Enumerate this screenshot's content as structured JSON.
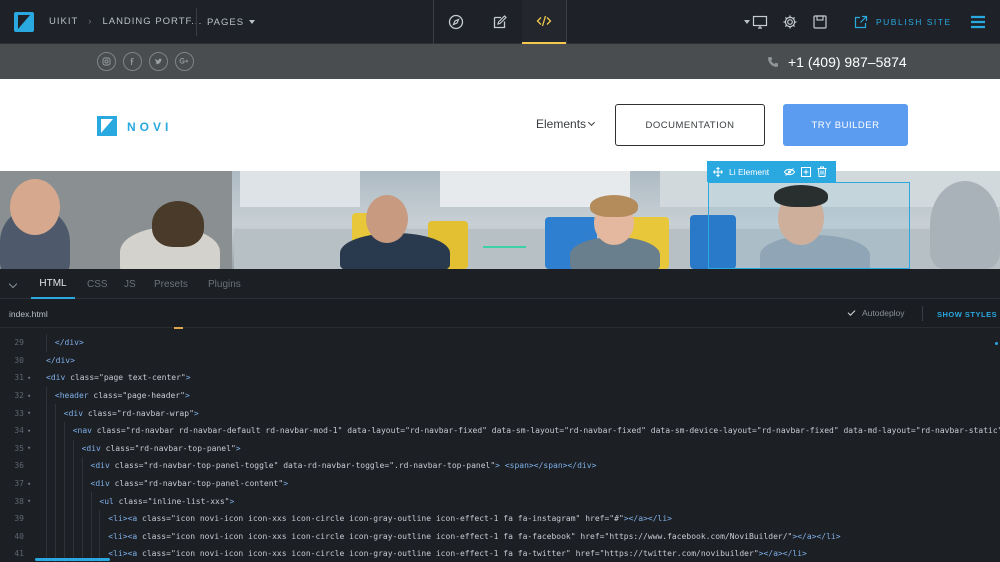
{
  "topbar": {
    "breadcrumb": [
      "UIKIT",
      "LANDING PORTF..."
    ],
    "breadcrumb_sep": "›",
    "pages_label": "PAGES",
    "modes": [
      {
        "icon": "compass-icon",
        "active": false
      },
      {
        "icon": "edit-icon",
        "active": false
      },
      {
        "icon": "code-icon",
        "active": true
      }
    ],
    "tools": [
      "monitor-icon",
      "gear-icon",
      "save-icon"
    ],
    "publish_label": "PUBLISH SITE"
  },
  "site": {
    "phone": "+1 (409) 987–5874",
    "socials": [
      "instagram-icon",
      "facebook-icon",
      "twitter-icon",
      "google-plus-icon"
    ],
    "brand": "NOVI",
    "elements_label": "Elements",
    "documentation_label": "DOCUMENTATION",
    "try_label": "TRY BUILDER",
    "selection_label": "Li Element"
  },
  "editor": {
    "tabs": [
      {
        "label": "HTML",
        "active": true
      },
      {
        "label": "CSS",
        "active": false
      },
      {
        "label": "JS",
        "active": false
      },
      {
        "label": "Presets",
        "active": false
      },
      {
        "label": "Plugins",
        "active": false
      }
    ],
    "filename": "index.html",
    "autodeploy_label": "Autodeploy",
    "show_styles_label": "SHOW STYLES",
    "lines": [
      {
        "n": "29",
        "fold": false,
        "indent": 1,
        "code": "</div>"
      },
      {
        "n": "30",
        "fold": false,
        "indent": 0,
        "code": "</div>"
      },
      {
        "n": "31",
        "fold": true,
        "indent": 0,
        "code": "<div class=\"page text-center\">"
      },
      {
        "n": "32",
        "fold": true,
        "indent": 1,
        "code": "<header class=\"page-header\">"
      },
      {
        "n": "33",
        "fold": true,
        "indent": 2,
        "code": "<div class=\"rd-navbar-wrap\">"
      },
      {
        "n": "34",
        "fold": true,
        "indent": 3,
        "code": "<nav class=\"rd-navbar rd-navbar-default rd-navbar-mod-1\" data-layout=\"rd-navbar-fixed\" data-sm-layout=\"rd-navbar-fixed\" data-sm-device-layout=\"rd-navbar-fixed\" data-md-layout=\"rd-navbar-static\" data-md-device"
      },
      {
        "n": "35",
        "fold": true,
        "indent": 4,
        "code": "<div class=\"rd-navbar-top-panel\">"
      },
      {
        "n": "36",
        "fold": false,
        "indent": 5,
        "code": "<div class=\"rd-navbar-top-panel-toggle\" data-rd-navbar-toggle=\".rd-navbar-top-panel\"> <span></span></div>"
      },
      {
        "n": "37",
        "fold": true,
        "indent": 5,
        "code": "<div class=\"rd-navbar-top-panel-content\">"
      },
      {
        "n": "38",
        "fold": true,
        "indent": 6,
        "code": "<ul class=\"inline-list-xxs\">"
      },
      {
        "n": "39",
        "fold": false,
        "indent": 7,
        "code": "<li><a class=\"icon novi-icon icon-xxs icon-circle icon-gray-outline icon-effect-1 fa fa-instagram\" href=\"#\"></a></li>"
      },
      {
        "n": "40",
        "fold": false,
        "indent": 7,
        "code": "<li><a class=\"icon novi-icon icon-xxs icon-circle icon-gray-outline icon-effect-1 fa fa-facebook\" href=\"https://www.facebook.com/NoviBuilder/\"></a></li>"
      },
      {
        "n": "41",
        "fold": false,
        "indent": 7,
        "code": "<li><a class=\"icon novi-icon icon-xxs icon-circle icon-gray-outline icon-effect-1 fa fa-twitter\" href=\"https://twitter.com/novibuilder\"></a></li>"
      }
    ]
  }
}
